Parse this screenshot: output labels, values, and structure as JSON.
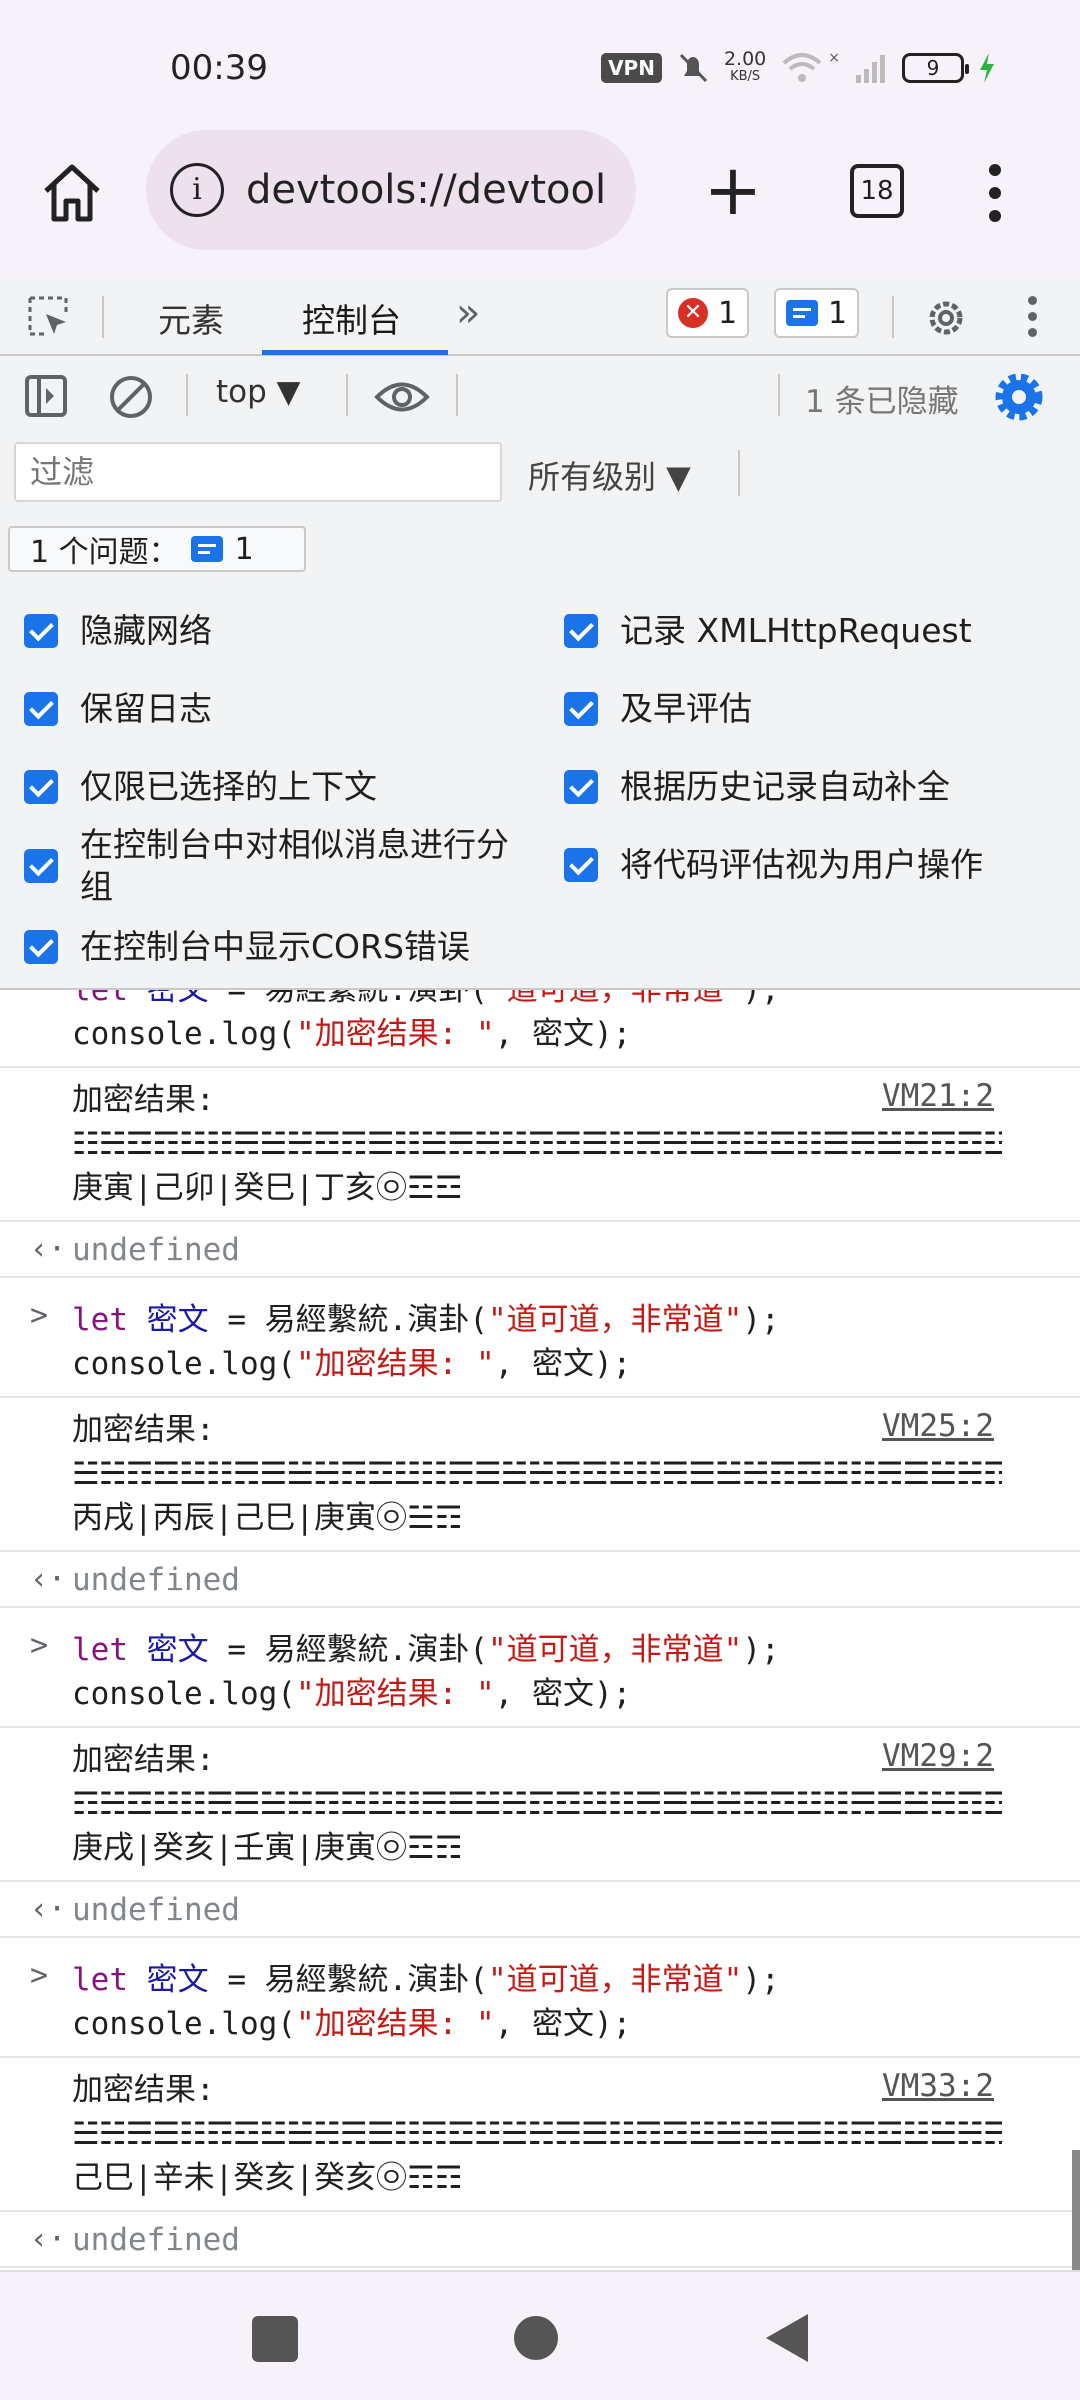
{
  "status_bar": {
    "time": "00:39",
    "vpn": "VPN",
    "net_speed": "2.00",
    "net_unit": "KB/S",
    "battery": "9",
    "wifi_x": "×"
  },
  "browser": {
    "url": "devtools://devtool",
    "info_glyph": "i",
    "new_tab_glyph": "+",
    "tab_count": "18"
  },
  "devtools_tabs": {
    "elements": "元素",
    "console": "控制台",
    "more": "»",
    "error_count": "1",
    "error_glyph": "✕",
    "message_count": "1"
  },
  "toolbar": {
    "context": "top ▼",
    "hidden": "1 条已隐藏"
  },
  "filter": {
    "placeholder": "过滤",
    "levels": "所有级别 ▼"
  },
  "issues": {
    "label": "1 个问题：",
    "count": "1"
  },
  "settings": {
    "options": [
      {
        "label": "隐藏网络",
        "checked": true
      },
      {
        "label": "保留日志",
        "checked": true
      },
      {
        "label": "仅限已选择的上下文",
        "checked": true
      },
      {
        "label": "在控制台中对相似消息进行分组",
        "checked": true
      },
      {
        "label": "在控制台中显示CORS错误",
        "checked": true
      },
      {
        "label": "记录 XMLHttpRequest",
        "checked": true
      },
      {
        "label": "及早评估",
        "checked": true
      },
      {
        "label": "根据历史记录自动补全",
        "checked": true
      },
      {
        "label": "将代码评估视为用户操作",
        "checked": true
      }
    ]
  },
  "console": {
    "input_glyph": ">",
    "result_glyph": "‹·",
    "partial_line1": "let 密文 = 易經繫統.演卦(\"道可道，非常道\");",
    "code": {
      "kw": "let",
      "var": "密文",
      "eq": " = ",
      "fn": "易經繫統.演卦(",
      "arg": "\"道可道，非常道\"",
      "close": ");",
      "line2_prefix": "console.log(",
      "line2_str": "\"加密结果: \"",
      "line2_suffix": ", 密文);"
    },
    "undefined": "undefined",
    "first_output": {
      "label": "加密结果:",
      "source": "VM21:2",
      "cipher": "☷☵☲☶☳☷☴☱☵☲☶☰☷☱☴☵☳☶☲☰☷☴☵☱☶☳☲☷☰☴☱☵☶☲☳☷䷀",
      "stems": "庚寅|己卯|癸巳|丁亥㉧☲☲"
    },
    "outputs": [
      {
        "label": "加密结果:",
        "source": "VM25:2",
        "cipher": "☱☵☶☲☳☷☴☰☱☵☶☲☳☷☴☰☱☵☶☲☳☷☴☰☱☵☶☲☳☷☴☰☱☵☶☲䷀",
        "stems": "丙戌|丙辰|己巳|庚寅㉧☱☶"
      },
      {
        "label": "加密结果:",
        "source": "VM29:2",
        "cipher": "☶☵☲☳☷☴☰☱☵☶☲☳☷☴☰☱☵☶☲☳☷☴☰☱☵☶☲☳☷☴☰☱☵☶☲䷀",
        "stems": "庚戌|癸亥|壬寅|庚寅㉧☲☶"
      },
      {
        "label": "加密结果:",
        "source": "VM33:2",
        "cipher": "☱☵☴☰☷☶☲☳☱☵☴☰☷☶☲☳☱☵☴☰☷☶☲☳☱☵☴☰☷☶☲☳☱☵☴☰䷀",
        "stems": "己巳|辛未|癸亥|癸亥㉧☶☶"
      }
    ]
  },
  "colors": {
    "accent": "#1a73e8",
    "error": "#d93025",
    "keyword": "#881280",
    "variable": "#1a1aa6",
    "string": "#c41a16"
  }
}
